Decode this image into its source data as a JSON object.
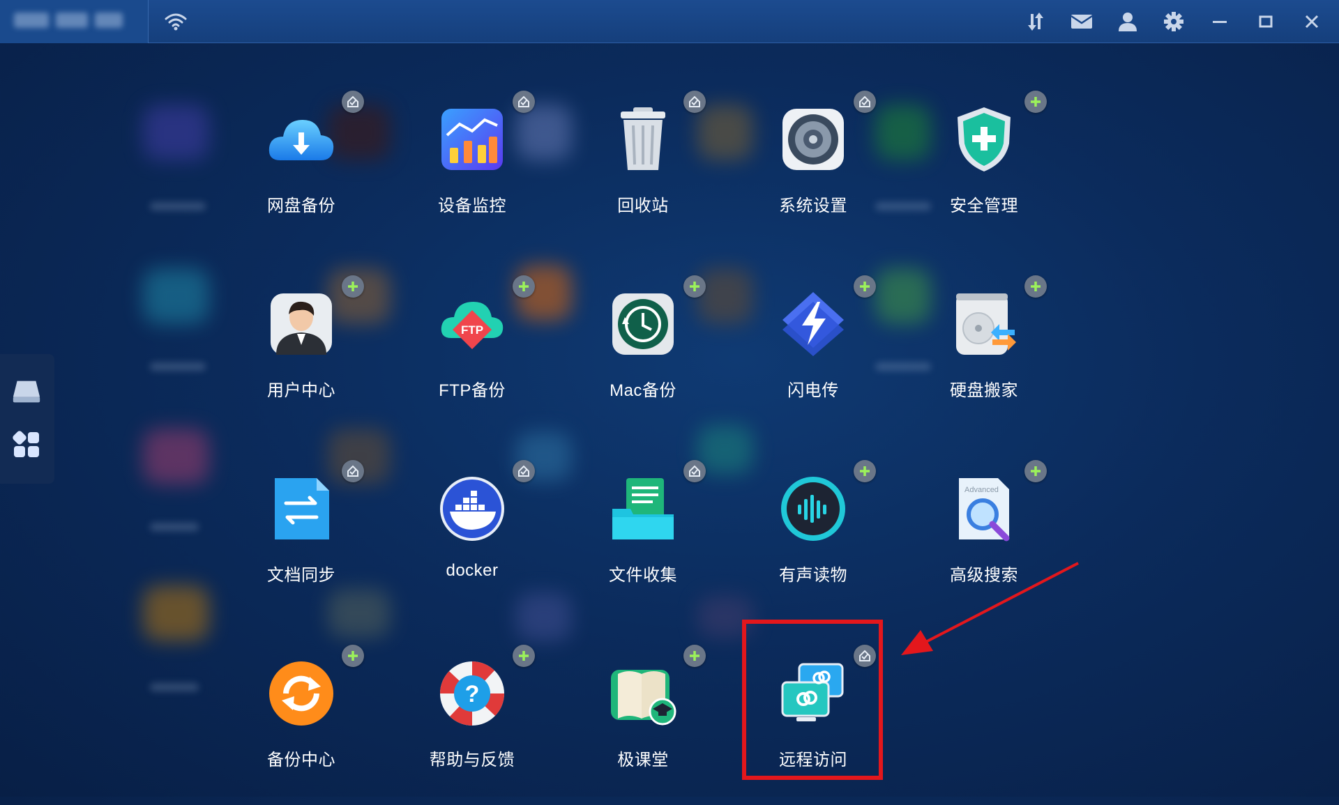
{
  "topbar": {
    "brand_blurred": true,
    "left_icons": [
      "wifi-icon"
    ],
    "right_icons": [
      "transfer-icon",
      "mail-icon",
      "user-icon",
      "settings-icon",
      "minimize-icon",
      "maximize-icon",
      "close-icon"
    ]
  },
  "left_dock": {
    "items": [
      "drive-icon",
      "apps-grid-icon"
    ]
  },
  "apps": [
    {
      "label": "网盘备份",
      "icon": "cloud-download-icon",
      "badge": "installed"
    },
    {
      "label": "设备监控",
      "icon": "device-monitor-icon",
      "badge": "installed"
    },
    {
      "label": "回收站",
      "icon": "trash-icon",
      "badge": "installed"
    },
    {
      "label": "系统设置",
      "icon": "system-settings-icon",
      "badge": "installed"
    },
    {
      "label": "安全管理",
      "icon": "security-shield-icon",
      "badge": "add"
    },
    {
      "label": "用户中心",
      "icon": "user-center-icon",
      "badge": "add"
    },
    {
      "label": "FTP备份",
      "icon": "ftp-backup-icon",
      "badge": "add"
    },
    {
      "label": "Mac备份",
      "icon": "mac-backup-icon",
      "badge": "add"
    },
    {
      "label": "闪电传",
      "icon": "lightning-transfer-icon",
      "badge": "add"
    },
    {
      "label": "硬盘搬家",
      "icon": "disk-migration-icon",
      "badge": "add"
    },
    {
      "label": "文档同步",
      "icon": "doc-sync-icon",
      "badge": "installed"
    },
    {
      "label": "docker",
      "icon": "docker-icon",
      "badge": "installed"
    },
    {
      "label": "文件收集",
      "icon": "file-collect-icon",
      "badge": "installed"
    },
    {
      "label": "有声读物",
      "icon": "audiobook-icon",
      "badge": "add"
    },
    {
      "label": "高级搜索",
      "icon": "advanced-search-icon",
      "badge": "add"
    },
    {
      "label": "备份中心",
      "icon": "backup-center-icon",
      "badge": "add"
    },
    {
      "label": "帮助与反馈",
      "icon": "help-feedback-icon",
      "badge": "add"
    },
    {
      "label": "极课堂",
      "icon": "classroom-icon",
      "badge": "add"
    },
    {
      "label": "远程访问",
      "icon": "remote-access-icon",
      "badge": "installed",
      "highlighted": true
    }
  ],
  "icon_texts": {
    "ftp": "FTP",
    "advanced": "Advanced",
    "help": "?"
  },
  "colors": {
    "background": "#0b2b5c",
    "topbar": "#1a4789",
    "highlight": "#e3171c",
    "badge_add": "#9cf25a",
    "badge_installed": "#e8eef6"
  }
}
